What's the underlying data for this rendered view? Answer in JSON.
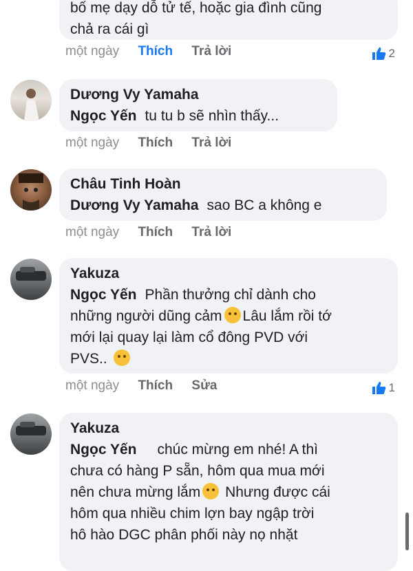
{
  "comments": [
    {
      "text_line1": "bố mẹ dạy dỗ tử tế, hoặc gia đình cũng",
      "text_line2": "chả ra cái gì",
      "time": "một ngày",
      "like": "Thích",
      "reply": "Trả lời",
      "likes_count": "2"
    },
    {
      "author": "Dương Vy Yamaha",
      "mention": "Ngọc Yến",
      "text": "tu tu b sẽ nhìn thấy...",
      "time": "một ngày",
      "like": "Thích",
      "reply": "Trả lời"
    },
    {
      "author": "Châu Tinh Hoàn",
      "mention": "Dương Vy Yamaha",
      "text": "sao BC a không e",
      "time": "một ngày",
      "like": "Thích",
      "reply": "Trả lời"
    },
    {
      "author": "Yakuza",
      "mention": "Ngọc Yến",
      "text_line1": "Phần thưởng chỉ dành cho",
      "text_line2": "những người dũng cảm",
      "text_line2b": "Lâu lắm rồi tớ",
      "text_line3": "mới lại quay lại làm cổ đông PVD với",
      "text_line4": "PVS..",
      "time": "một ngày",
      "like": "Thích",
      "edit": "Sửa",
      "likes_count": "1"
    },
    {
      "author": "Yakuza",
      "mention": "Ngọc Yến",
      "text_line1": "chúc mừng em nhé! A thì",
      "text_line2": "chưa có hàng P sẵn, hôm qua mua mới",
      "text_line3": "nên chưa mừng lắm",
      "text_line3b": "Nhưng được cái",
      "text_line4": "hôm qua nhiều chim lợn bay ngập trời",
      "text_line5": "hô hào DGC phân phối này nọ  nhặt"
    }
  ],
  "colors": {
    "liked": "#1877f2",
    "bubble": "#f0f2f5"
  }
}
